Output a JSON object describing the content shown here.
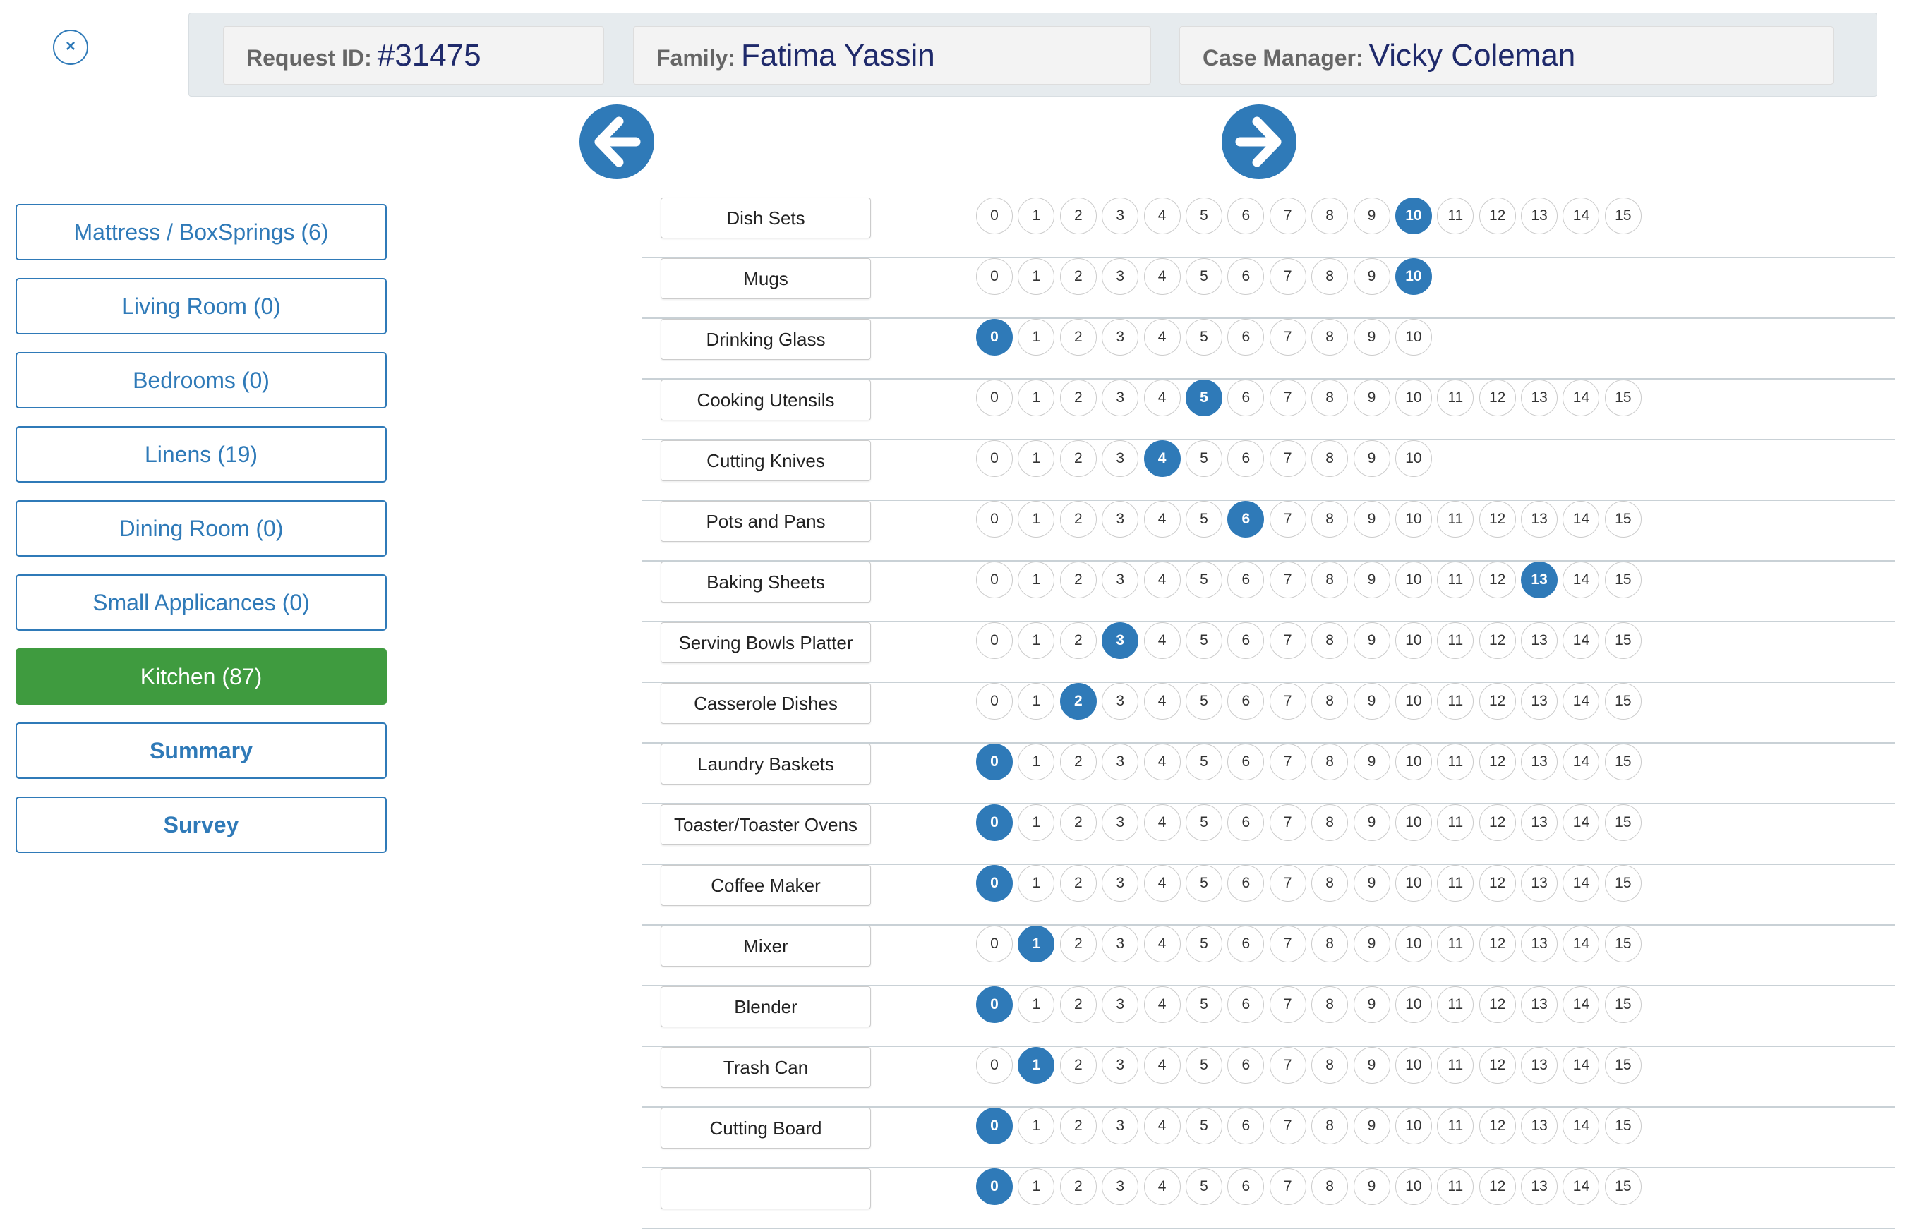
{
  "header": {
    "close_glyph": "×",
    "request_id_label": "Request ID:",
    "request_id_value": "#31475",
    "family_label": "Family:",
    "family_value": "Fatima Yassin",
    "case_manager_label": "Case Manager:",
    "case_manager_value": "Vicky Coleman"
  },
  "nav": {
    "prev_icon": "arrow-left-icon",
    "next_icon": "arrow-right-icon"
  },
  "categories": [
    {
      "label": "Mattress / BoxSprings (6)"
    },
    {
      "label": "Living Room (0)"
    },
    {
      "label": "Bedrooms (0)"
    },
    {
      "label": "Linens (19)"
    },
    {
      "label": "Dining Room (0)"
    },
    {
      "label": "Small Applicances (0)"
    },
    {
      "label": "Kitchen (87)",
      "active": true
    },
    {
      "label": "Summary",
      "bold": true
    },
    {
      "label": "Survey",
      "bold": true
    }
  ],
  "colors": {
    "accent": "#2f7ab8",
    "active_category": "#3f9b3f",
    "header_bg": "#e6ebee"
  },
  "items": [
    {
      "name": "Dish Sets",
      "max": 15,
      "selected": 10
    },
    {
      "name": "Mugs",
      "max": 10,
      "selected": 10
    },
    {
      "name": "Drinking Glass",
      "max": 10,
      "selected": 0
    },
    {
      "name": "Cooking Utensils",
      "max": 15,
      "selected": 5
    },
    {
      "name": "Cutting Knives",
      "max": 10,
      "selected": 4
    },
    {
      "name": "Pots and Pans",
      "max": 15,
      "selected": 6
    },
    {
      "name": "Baking Sheets",
      "max": 15,
      "selected": 13
    },
    {
      "name": "Serving Bowls Platter",
      "max": 15,
      "selected": 3
    },
    {
      "name": "Casserole Dishes",
      "max": 15,
      "selected": 2
    },
    {
      "name": "Laundry Baskets",
      "max": 15,
      "selected": 0
    },
    {
      "name": "Toaster/Toaster Ovens",
      "max": 15,
      "selected": 0
    },
    {
      "name": "Coffee Maker",
      "max": 15,
      "selected": 0
    },
    {
      "name": "Mixer",
      "max": 15,
      "selected": 1
    },
    {
      "name": "Blender",
      "max": 15,
      "selected": 0
    },
    {
      "name": "Trash Can",
      "max": 15,
      "selected": 1
    },
    {
      "name": "Cutting Board",
      "max": 15,
      "selected": 0
    },
    {
      "name": "",
      "max": 15,
      "selected": 0
    }
  ]
}
